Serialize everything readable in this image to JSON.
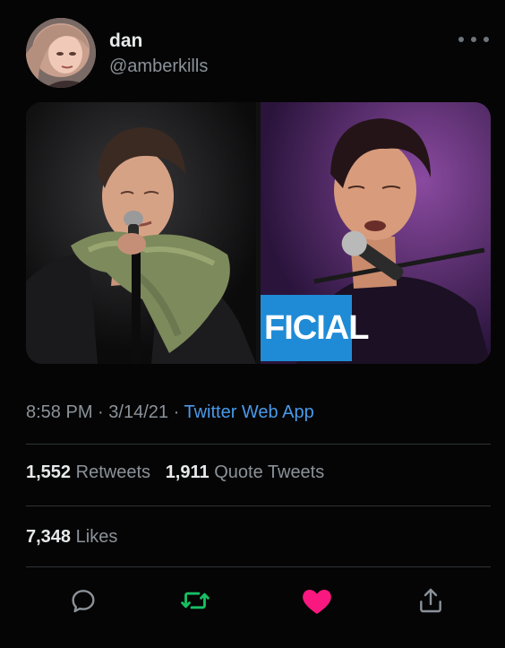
{
  "tweet": {
    "author": {
      "display_name": "dan",
      "handle": "@amberkills"
    },
    "media": {
      "overlay_text": "FICIAL"
    },
    "meta": {
      "time": "8:58 PM",
      "separator": "·",
      "date": "3/14/21",
      "source": "Twitter Web App"
    },
    "stats": {
      "retweets_count": "1,552",
      "retweets_label": "Retweets",
      "quote_count": "1,911",
      "quote_label": "Quote Tweets",
      "likes_count": "7,348",
      "likes_label": "Likes"
    },
    "actions": [
      {
        "icon": "reply-icon"
      },
      {
        "icon": "retweet-icon",
        "color": "#17bf63"
      },
      {
        "icon": "like-icon",
        "color": "#f91880"
      },
      {
        "icon": "share-icon"
      }
    ]
  }
}
